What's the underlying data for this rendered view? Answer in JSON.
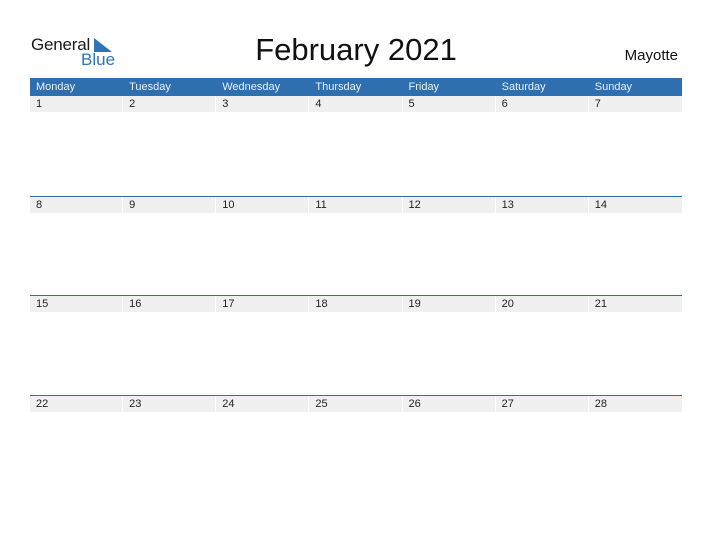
{
  "logo": {
    "line1": "General",
    "line2": "Blue",
    "brand_color": "#2e75b6"
  },
  "title": "February 2021",
  "country": "Mayotte",
  "header_color": "#2e6fb0",
  "weekdays": [
    "Monday",
    "Tuesday",
    "Wednesday",
    "Thursday",
    "Friday",
    "Saturday",
    "Sunday"
  ],
  "weeks": [
    [
      "1",
      "2",
      "3",
      "4",
      "5",
      "6",
      "7"
    ],
    [
      "8",
      "9",
      "10",
      "11",
      "12",
      "13",
      "14"
    ],
    [
      "15",
      "16",
      "17",
      "18",
      "19",
      "20",
      "21"
    ],
    [
      "22",
      "23",
      "24",
      "25",
      "26",
      "27",
      "28"
    ]
  ]
}
